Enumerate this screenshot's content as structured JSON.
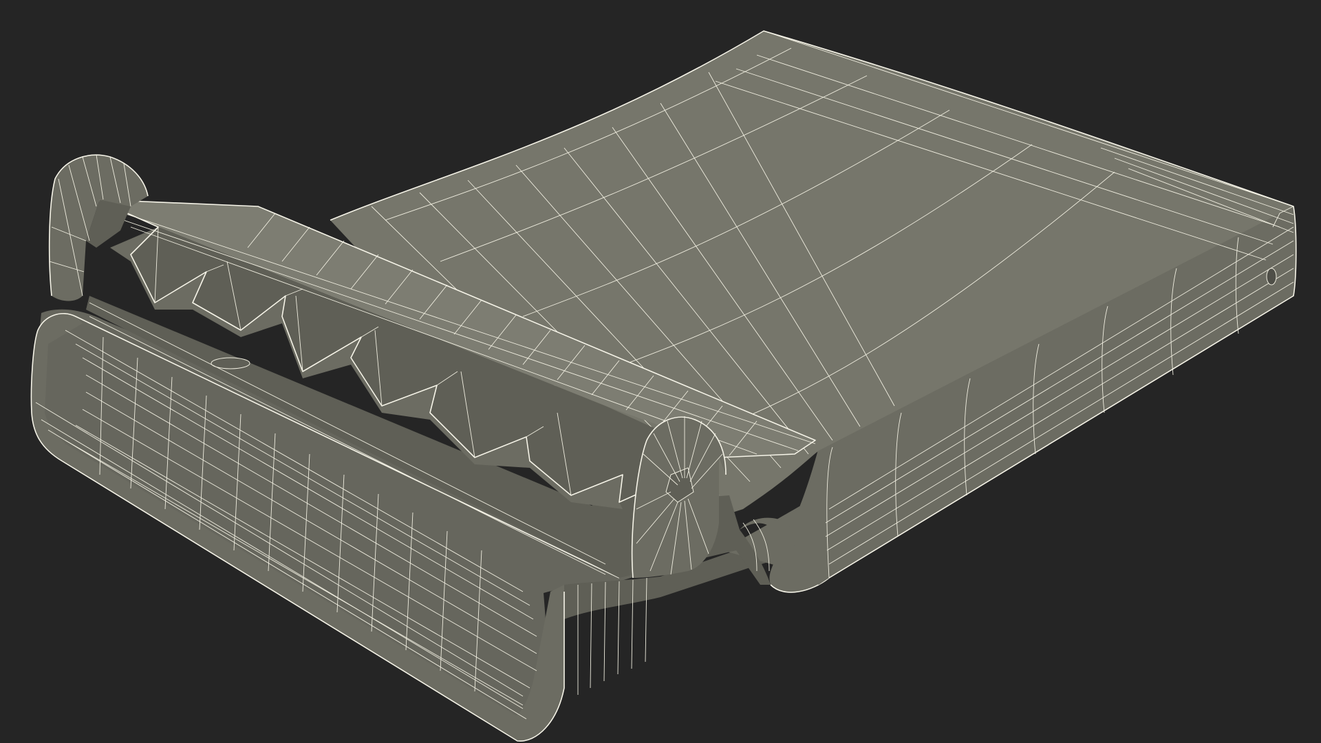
{
  "scene": {
    "background_color": "#252525",
    "surface_color": "#76766b",
    "wire_color": "#f0eee0",
    "subject": "wireframe-3d-model"
  }
}
